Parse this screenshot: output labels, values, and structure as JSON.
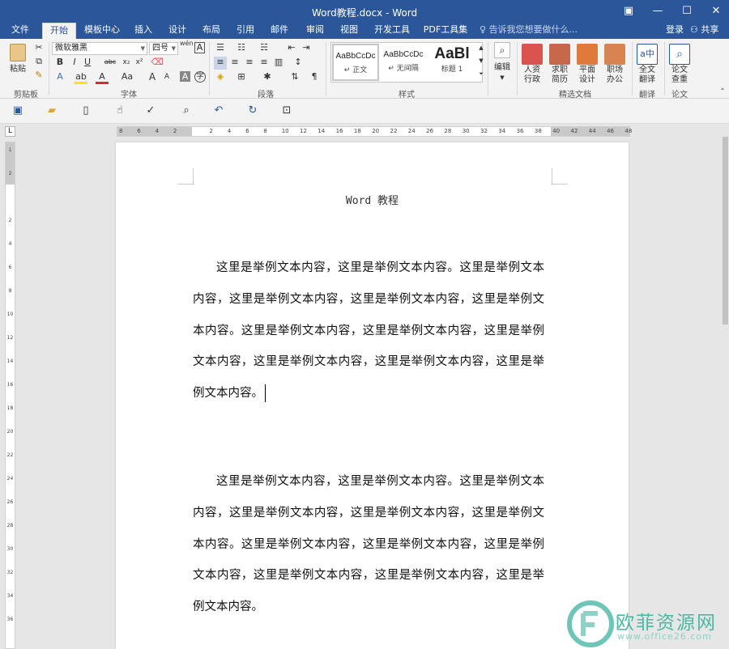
{
  "window": {
    "title": "Word教程.docx - Word",
    "btn_ribbon_options": "▣",
    "btn_minimize": "—",
    "btn_maximize": "☐",
    "btn_close": "✕"
  },
  "tabs": [
    "文件",
    "开始",
    "模板中心",
    "插入",
    "设计",
    "布局",
    "引用",
    "邮件",
    "审阅",
    "视图",
    "开发工具",
    "PDF工具集"
  ],
  "active_tab": "开始",
  "tell_me": "告诉我您想要做什么...",
  "login": "登录",
  "share": "共享",
  "ribbon": {
    "clipboard": {
      "paste": "粘贴",
      "label": "剪贴板"
    },
    "font": {
      "font_name": "微软雅黑",
      "font_size": "四号",
      "wen": "wén",
      "label": "字体",
      "buttons": [
        "B",
        "I",
        "U",
        "abc",
        "x₂",
        "x²",
        "A",
        "A",
        "Aa",
        "A",
        "A",
        "A"
      ]
    },
    "paragraph": {
      "label": "段落"
    },
    "styles": {
      "label": "样式",
      "items": [
        {
          "sample": "AaBbCcDc",
          "name": "↵ 正文"
        },
        {
          "sample": "AaBbCcDc",
          "name": "↵ 无间隔"
        },
        {
          "sample": "AaBl",
          "name": "标题 1"
        }
      ]
    },
    "editing": {
      "label": "编辑"
    },
    "featured": {
      "label": "精选文档",
      "items": [
        "人资\n行政",
        "求职\n简历",
        "平面\n设计",
        "职场\n办公"
      ]
    },
    "translate": {
      "button": "全文\n翻译",
      "label": "翻译"
    },
    "paper": {
      "button": "论文\n查重",
      "label": "论文"
    }
  },
  "ruler": {
    "h_ticks": [
      "8",
      "6",
      "4",
      "2",
      "",
      "2",
      "4",
      "6",
      "8",
      "10",
      "12",
      "14",
      "16",
      "18",
      "20",
      "22",
      "24",
      "26",
      "28",
      "30",
      "32",
      "34",
      "36",
      "38",
      "40",
      "42",
      "44",
      "46",
      "48"
    ],
    "v_ticks": [
      "1",
      "2",
      "",
      "2",
      "4",
      "6",
      "8",
      "10",
      "12",
      "14",
      "16",
      "18",
      "20",
      "22",
      "24",
      "26",
      "28",
      "30",
      "32",
      "34",
      "36"
    ],
    "corner": "L"
  },
  "document": {
    "header": "Word 教程",
    "paragraphs": [
      "这里是举例文本内容，这里是举例文本内容。这里是举例文本内容，这里是举例文本内容，这里是举例文本内容，这里是举例文本内容。这里是举例文本内容，这里是举例文本内容，这里是举例文本内容，这里是举例文本内容，这里是举例文本内容，这里是举例文本内容。",
      "这里是举例文本内容，这里是举例文本内容。这里是举例文本内容，这里是举例文本内容，这里是举例文本内容，这里是举例文本内容。这里是举例文本内容，这里是举例文本内容，这里是举例文本内容，这里是举例文本内容，这里是举例文本内容，这里是举例文本内容。"
    ]
  },
  "watermark": {
    "text": "欧菲资源网",
    "url": "www.office26.com"
  },
  "colors": {
    "accent": "#2b579a",
    "watermark": "#4bb8a4"
  }
}
